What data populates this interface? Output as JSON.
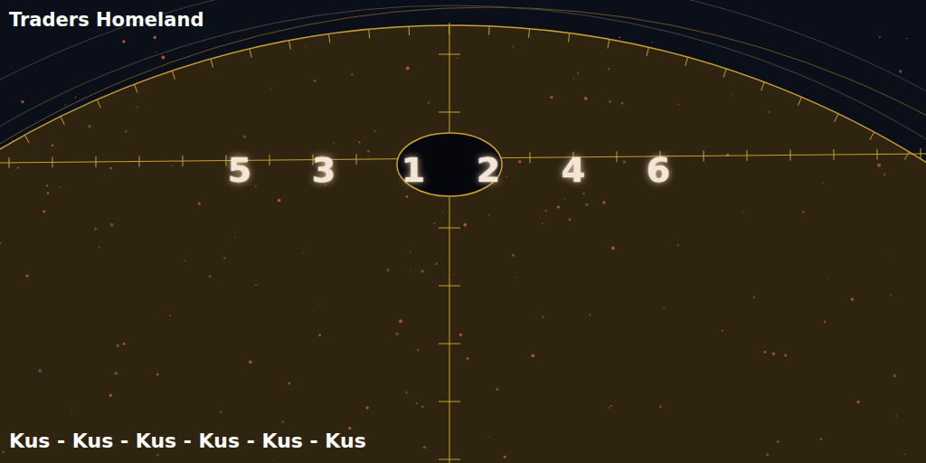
{
  "title": "Traders Homeland",
  "markers": [
    {
      "label": "5"
    },
    {
      "label": "3"
    },
    {
      "label": "1"
    },
    {
      "label": "2"
    },
    {
      "label": "4"
    },
    {
      "label": "6"
    }
  ],
  "route": "Kus - Kus - Kus - Kus - Kus - Kus"
}
